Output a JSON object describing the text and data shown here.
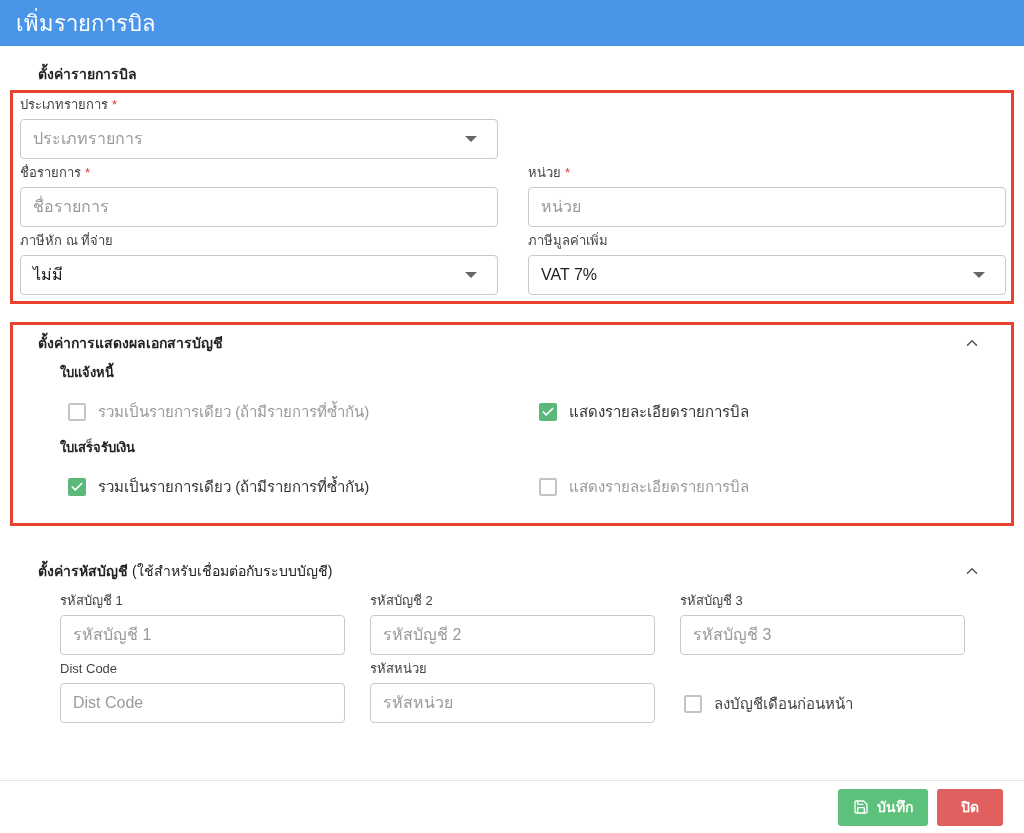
{
  "window": {
    "title": "เพิ่มรายการบิล"
  },
  "bill_settings": {
    "title": "ตั้งค่ารายการบิล",
    "highlighted": true,
    "rows": [
      [
        {
          "kind": "select",
          "label": "ประเภทรายการ",
          "required_mark": "*",
          "placeholder": "ประเภทรายการ"
        }
      ],
      [
        {
          "kind": "input",
          "label": "ชื่อรายการ",
          "required_mark": "*",
          "placeholder": "ชื่อรายการ"
        },
        {
          "kind": "input",
          "label": "หน่วย",
          "required_mark": "*",
          "placeholder": "หน่วย"
        }
      ],
      [
        {
          "kind": "select",
          "label": "ภาษีหัก ณ ที่จ่าย",
          "value": "ไม่มี"
        },
        {
          "kind": "select",
          "label": "ภาษีมูลค่าเพิ่ม",
          "value": "VAT 7%"
        }
      ]
    ]
  },
  "display_settings": {
    "title": "ตั้งค่าการแสดงผลเอกสารบัญชี",
    "highlighted": true,
    "expanded": true,
    "groups": [
      {
        "title": "ใบแจ้งหนี้",
        "options": [
          {
            "label": "รวมเป็นรายการเดียว (ถ้ามีรายการที่ซ้ำกัน)",
            "checked": false
          },
          {
            "label": "แสดงรายละเอียดรายการบิล",
            "checked": true
          }
        ]
      },
      {
        "title": "ใบเสร็จรับเงิน",
        "options": [
          {
            "label": "รวมเป็นรายการเดียว (ถ้ามีรายการที่ซ้ำกัน)",
            "checked": true
          },
          {
            "label": "แสดงรายละเอียดรายการบิล",
            "checked": false
          }
        ]
      }
    ]
  },
  "account_settings": {
    "title": "ตั้งค่ารหัสบัญชี",
    "note": "(ใช้สำหรับเชื่อมต่อกับระบบบัญชี)",
    "highlighted": false,
    "expanded": true,
    "rows": [
      [
        {
          "kind": "input",
          "label": "รหัสบัญชี 1",
          "placeholder": "รหัสบัญชี 1"
        },
        {
          "kind": "input",
          "label": "รหัสบัญชี 2",
          "placeholder": "รหัสบัญชี 2"
        },
        {
          "kind": "input",
          "label": "รหัสบัญชี 3",
          "placeholder": "รหัสบัญชี 3"
        }
      ],
      [
        {
          "kind": "input",
          "label": "Dist Code",
          "placeholder": "Dist Code"
        },
        {
          "kind": "input",
          "label": "รหัสหน่วย",
          "placeholder": "รหัสหน่วย"
        },
        {
          "kind": "checkbox",
          "label": "ลงบัญชีเดือนก่อนหน้า",
          "checked": false
        }
      ]
    ]
  },
  "buttons": [
    {
      "kind": "save",
      "label": "บันทึก"
    },
    {
      "kind": "close",
      "label": "ปิด"
    }
  ]
}
